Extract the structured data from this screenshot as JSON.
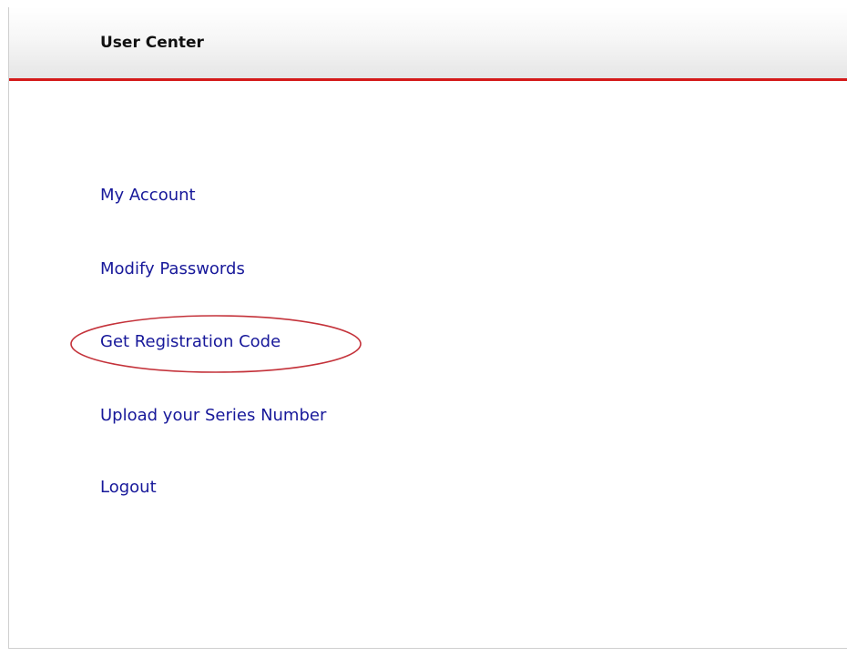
{
  "panel": {
    "title": "User Center",
    "accent_color": "#d41a1a"
  },
  "menu": {
    "items": [
      {
        "label": "My Account"
      },
      {
        "label": "Modify Passwords"
      },
      {
        "label": "Get Registration Code",
        "highlighted": true
      },
      {
        "label": "Upload your Series Number"
      },
      {
        "label": "Logout"
      }
    ],
    "link_color": "#17189a"
  },
  "annotation": {
    "type": "ellipse-highlight",
    "color": "#c4323a",
    "target": "Get Registration Code"
  }
}
